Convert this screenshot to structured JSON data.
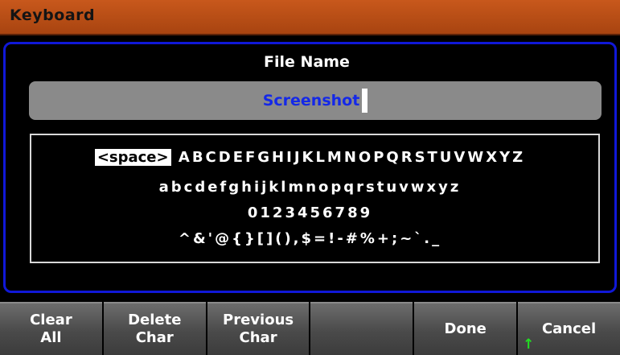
{
  "window": {
    "title": "Keyboard"
  },
  "file_name": {
    "label": "File Name",
    "value": "Screenshot"
  },
  "keyboard": {
    "space_key": "<space>",
    "row1": "ABCDEFGHIJKLMNOPQRSTUVWXYZ",
    "row2": "abcdefghijklmnopqrstuvwxyz",
    "row3": "0123456789",
    "row4": "^&'@{}[](),$=!-#%+;~`._"
  },
  "softkeys": [
    {
      "label": "Clear\nAll"
    },
    {
      "label": "Delete\nChar"
    },
    {
      "label": "Previous\nChar"
    },
    {
      "label": ""
    },
    {
      "label": "Done"
    },
    {
      "label": "Cancel"
    }
  ],
  "icons": {
    "shift_indicator": "arrow-up-icon",
    "indicator_color": "#22e022"
  }
}
